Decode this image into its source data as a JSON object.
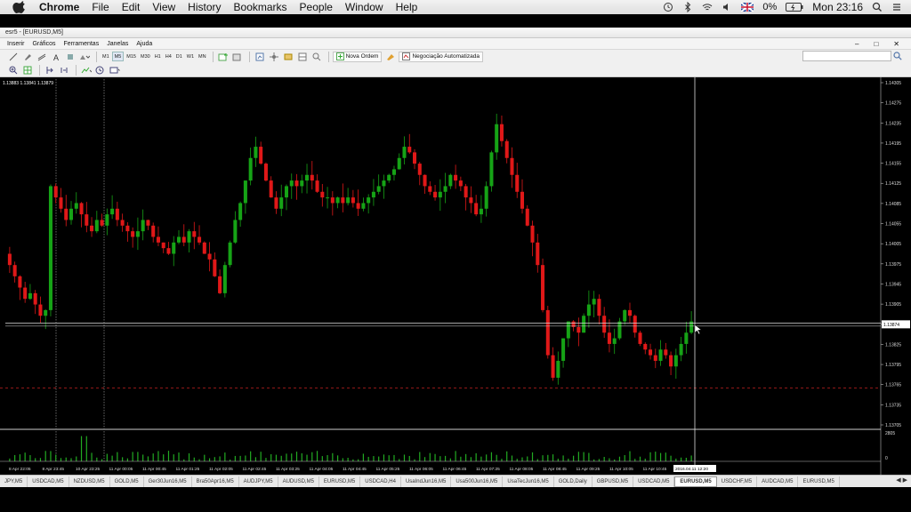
{
  "mac_menu": {
    "app": "Chrome",
    "items": [
      "File",
      "Edit",
      "View",
      "History",
      "Bookmarks",
      "People",
      "Window",
      "Help"
    ],
    "battery": "0%",
    "clock": "Mon 23:16"
  },
  "window": {
    "title": "esr5 - [EURUSD,M5]",
    "menu": [
      "Inserir",
      "Gráficos",
      "Ferramentas",
      "Janelas",
      "Ajuda"
    ]
  },
  "toolbar": {
    "timeframes": [
      "M1",
      "M5",
      "M15",
      "M30",
      "H1",
      "H4",
      "D1",
      "W1",
      "MN"
    ],
    "new_order": "Nova Ordem",
    "auto_trading": "Negociação Automatizada"
  },
  "chart_data": {
    "type": "candlestick",
    "symbol": "EURUSD",
    "timeframe": "M5",
    "ohlc_header": "1.13883 1.13841 1.13879",
    "ylim": [
      1.1369,
      1.1431
    ],
    "y_ticks": [
      "1.14305",
      "1.14275",
      "1.14235",
      "1.14195",
      "1.14155",
      "1.14125",
      "1.14085",
      "1.14055",
      "1.14005",
      "1.13975",
      "1.13945",
      "1.13905",
      "1.13855",
      "1.13825",
      "1.13795",
      "1.13765",
      "1.13735",
      "1.13705"
    ],
    "current_price": "1.13874",
    "x_ticks": [
      "8 Apr 22:05",
      "8 Apr 23:45",
      "10 Apr 23:25",
      "11 Apr 00:05",
      "11 Apr 00:45",
      "11 Apr 01:25",
      "11 Apr 02:05",
      "11 Apr 02:45",
      "11 Apr 03:25",
      "11 Apr 04:05",
      "11 Apr 04:45",
      "11 Apr 05:25",
      "11 Apr 06:05",
      "11 Apr 06:45",
      "11 Apr 07:25",
      "11 Apr 08:05",
      "11 Apr 08:45",
      "11 Apr 09:25",
      "11 Apr 10:05",
      "11 Apr 10:45",
      "11 Apr 11:"
    ],
    "crosshair_time": "2016.04.11 12:20",
    "volume_ticks": [
      "2805",
      "0"
    ],
    "close_path": [
      1.1398,
      1.1396,
      1.1394,
      1.1392,
      1.1393,
      1.1391,
      1.1389,
      1.139,
      1.1412,
      1.141,
      1.1408,
      1.1406,
      1.1408,
      1.1409,
      1.1407,
      1.1405,
      1.1404,
      1.1406,
      1.1405,
      1.1407,
      1.1408,
      1.1406,
      1.1405,
      1.1404,
      1.1403,
      1.1404,
      1.1406,
      1.1405,
      1.1403,
      1.1402,
      1.1401,
      1.14,
      1.1402,
      1.1403,
      1.1402,
      1.1404,
      1.1403,
      1.1402,
      1.14,
      1.1399,
      1.1396,
      1.1393,
      1.1398,
      1.1402,
      1.1406,
      1.1409,
      1.1413,
      1.1417,
      1.1419,
      1.1416,
      1.1413,
      1.141,
      1.1408,
      1.141,
      1.1412,
      1.1413,
      1.1412,
      1.1413,
      1.1414,
      1.1413,
      1.1411,
      1.141,
      1.141,
      1.1409,
      1.141,
      1.1409,
      1.141,
      1.1409,
      1.1408,
      1.1409,
      1.141,
      1.1411,
      1.1412,
      1.1413,
      1.1414,
      1.1415,
      1.1417,
      1.1419,
      1.1418,
      1.1416,
      1.1414,
      1.1412,
      1.1411,
      1.141,
      1.1411,
      1.1412,
      1.1414,
      1.1413,
      1.1412,
      1.141,
      1.1409,
      1.1407,
      1.1408,
      1.1412,
      1.1418,
      1.1423,
      1.142,
      1.1417,
      1.1414,
      1.1411,
      1.1408,
      1.1405,
      1.1402,
      1.1398,
      1.139,
      1.1382,
      1.1378,
      1.1381,
      1.1385,
      1.1388,
      1.1387,
      1.1386,
      1.1389,
      1.1391,
      1.1392,
      1.1389,
      1.1386,
      1.1384,
      1.1385,
      1.1388,
      1.139,
      1.1389,
      1.1386,
      1.1384,
      1.1383,
      1.1382,
      1.1381,
      1.1383,
      1.1382,
      1.138,
      1.1382,
      1.1384,
      1.1386,
      1.1388
    ]
  },
  "symbol_tabs": [
    "JPY,M5",
    "USDCAD,M5",
    "NZDUSD,M5",
    "GOLD,M5",
    "Ger30Jun16,M5",
    "Bra50Apr16,M5",
    "AUDJPY,M5",
    "AUDUSD,M5",
    "EURUSD,M5",
    "USDCAD,H4",
    "UsaIndJun16,M5",
    "Usa500Jun16,M5",
    "UsaTecJun16,M5",
    "GOLD,Daily",
    "GBPUSD,M5",
    "USDCAD,M5",
    "EURUSD,M5",
    "USDCHF,M5",
    "AUDCAD,M5",
    "EURUSD,M5"
  ],
  "active_tab_index": 16
}
